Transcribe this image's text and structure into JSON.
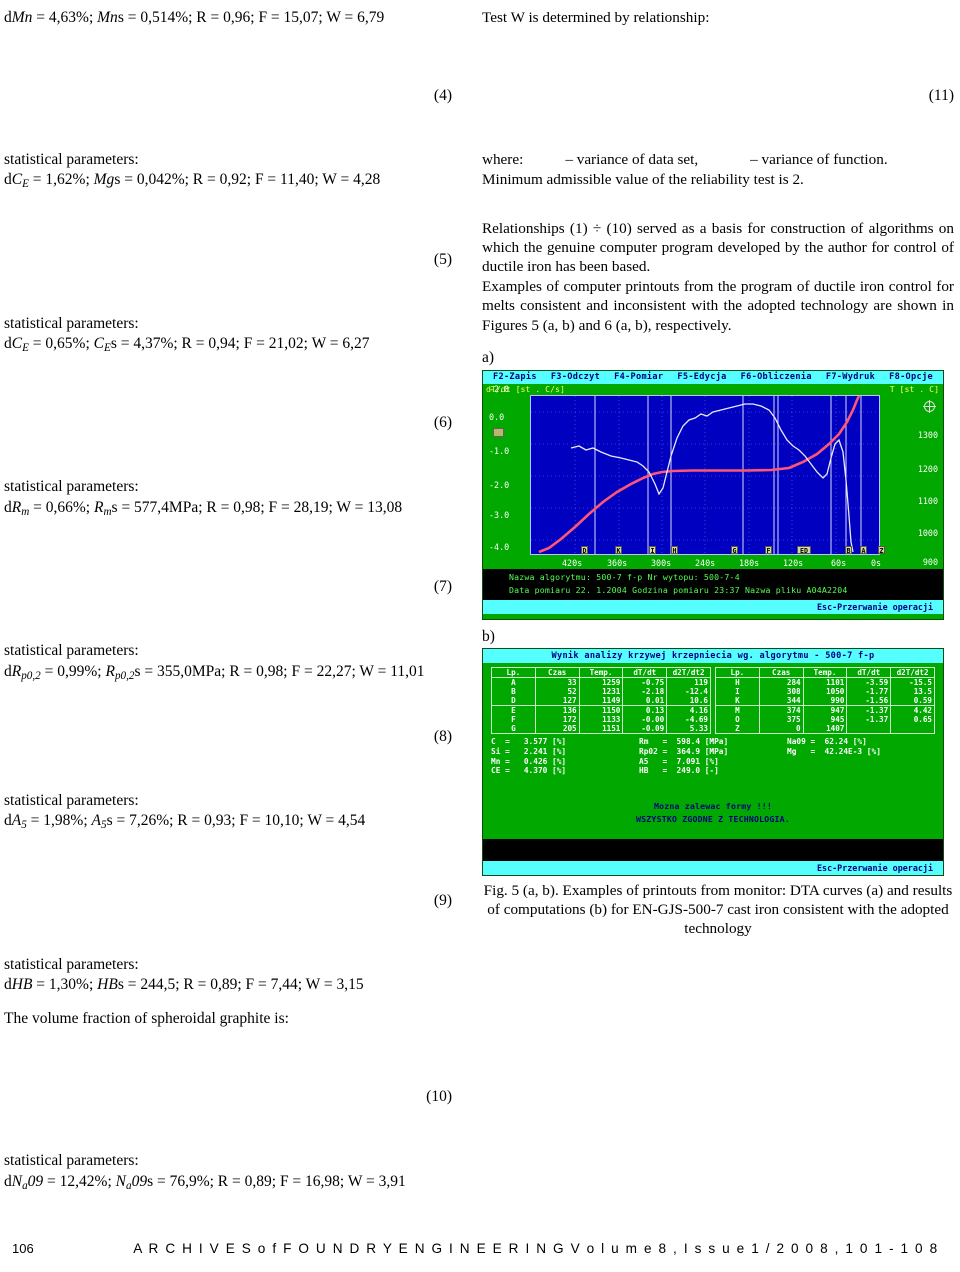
{
  "left_column": {
    "eq4_line": "d<i>Mn</i> = 4,63%; <i>Mn</i>s = 0,514%; R = 0,96; F = 15,07; W = 6,79",
    "eq4_number": "(4)",
    "stat_head": "statistical parameters:",
    "eq5_line": "d<i>C<sub>E</sub></i> = 1,62%; <i>Mg</i>s = 0,042%; R = 0,92; F = 11,40; W = 4,28",
    "eq5_number": "(5)",
    "eq6_line": "d<i>C<sub>E</sub></i> = 0,65%; <i>C<sub>E</sub></i>s = 4,37%; R = 0,94; F = 21,02; W = 6,27",
    "eq6_number": "(6)",
    "eq7_line": "d<i>R<sub>m</sub></i> = 0,66%; <i>R<sub>m</sub></i>s = 577,4MPa; R = 0,98; F = 28,19; W = 13,08",
    "eq7_number": "(7)",
    "eq8_line": "d<i>R<sub>p0,2</sub></i> = 0,99%; <i>R<sub>p0,2</sub></i>s = 355,0MPa; R = 0,98; F = 22,27; W = 11,01",
    "eq8_number": "(8)",
    "eq9_line": "d<i>A<sub>5</sub></i> = 1,98%; <i>A<sub>5</sub></i>s = 7,26%; R = 0,93; F = 10,10; W = 4,54",
    "eq9_number": "(9)",
    "eq10_line": "d<i>HB</i> = 1,30%; <i>HB</i>s = 244,5; R = 0,89; F = 7,44; W = 3,15",
    "volume_fraction_text": "The volume fraction of spheroidal graphite is:",
    "eq10_number": "(10)",
    "eq11_line": "d<i>N<sub>a</sub>09</i> = 12,42%; <i>N<sub>a</sub>09</i>s = 76,9%; R = 0,89; F = 16,98; W = 3,91"
  },
  "right_column": {
    "test_w_text": "Test W is determined by relationship:",
    "eq11_number": "(11)",
    "where_label": "where:",
    "where_a": "– variance of data set,",
    "where_b": "– variance of function.",
    "min_value_text": "Minimum admissible value of the reliability test is 2.",
    "para1": "Relationships (1) ÷ (10) served as a basis for construction of algorithms on which the genuine computer program developed by the author for control of ductile iron has been based.",
    "para2": "Examples of computer printouts from the program of ductile iron control for melts consistent and inconsistent with the adopted technology are shown in Figures 5 (a, b) and 6 (a, b), respectively.",
    "fig_a_label": "a)",
    "fig_b_label": "b)",
    "fig_caption": "Fig. 5 (a, b). Examples of printouts from monitor: DTA curves (a) and  results of computations (b) for EN-GJS-500-7 cast iron consistent with the adopted technology"
  },
  "screenshot_a": {
    "menu_items": [
      "F2-Zapis",
      "F3-Odczyt",
      "F4-Pomiar",
      "F5-Edycja",
      "F6-Obliczenia",
      "F7-Wydruk",
      "F8-Opcje"
    ],
    "axis_title_left": "dT/dt [st . C/s]",
    "axis_title_right": "T [st . C]",
    "y_ticks_left": [
      "0.0",
      "-1.0",
      "-2.0",
      "-3.0",
      "-4.0"
    ],
    "y_ticks_right": [
      "1300",
      "1200",
      "1100",
      "1000",
      "900"
    ],
    "x_ticks": [
      "420s",
      "360s",
      "300s",
      "240s",
      "180s",
      "120s",
      "60s",
      "0s"
    ],
    "markers": [
      "D",
      "K",
      "I",
      "H",
      "G",
      "F",
      "ED",
      "B",
      "A",
      "Z"
    ],
    "status_line1": "Nazwa algorytmu:      500-7     f-p    Nr wytopu: 500-7-4",
    "status_line2": "Data pomiaru 22. 1.2004   Godzina pomiaru 23:37   Nazwa pliku A04A2204",
    "esc_label": "Esc-Przerwanie operacji",
    "colors": {
      "screen_bg": "#00a800",
      "menu_bg": "#55ffff",
      "plot_bg": "#0000c0",
      "status_bg": "#000000",
      "curve_temp": "#ff5577",
      "curve_deriv": "#ffffff"
    }
  },
  "screenshot_b": {
    "title": "Wynik analizy krzywej krzepniecia wg. algorytmu - 500-7      f-p",
    "table_headers": [
      "Lp.",
      "Czas",
      "Temp.",
      "dT/dt",
      "d2T/dt2"
    ],
    "table_left_group1": [
      [
        "A",
        "33",
        "1259",
        "-0.75",
        "119"
      ],
      [
        "B",
        "52",
        "1231",
        "-2.18",
        "-12.4"
      ],
      [
        "D",
        "127",
        "1149",
        "0.01",
        "10.6"
      ]
    ],
    "table_left_group2": [
      [
        "E",
        "136",
        "1150",
        "0.13",
        "4.16"
      ],
      [
        "F",
        "172",
        "1133",
        "-0.00",
        "-4.69"
      ],
      [
        "G",
        "205",
        "1151",
        "-0.09",
        "5.33"
      ]
    ],
    "table_right_group1": [
      [
        "H",
        "284",
        "1101",
        "-3.59",
        "-15.5"
      ],
      [
        "I",
        "308",
        "1050",
        "-1.77",
        "13.5"
      ],
      [
        "K",
        "344",
        "990",
        "-1.56",
        "0.59"
      ]
    ],
    "table_right_group2": [
      [
        "M",
        "374",
        "947",
        "-1.37",
        "4.42"
      ],
      [
        "O",
        "375",
        "945",
        "-1.37",
        "0.65"
      ],
      [
        "Z",
        "0",
        "1407",
        "",
        ""
      ]
    ],
    "summary_col1": [
      "C  =   3.577 [%]",
      "Si =   2.241 [%]",
      "Mn =   0.426 [%]",
      "CE =   4.370 [%]"
    ],
    "summary_col2": [
      "Rm   =  598.4 [MPa]",
      "Rp02 =  364.9 [MPa]",
      "A5   =  7.091 [%]",
      "HB   =  249.0 [-]"
    ],
    "summary_col3": [
      "Na09 =  62.24 [%]",
      "Mg   =  42.24E-3 [%]"
    ],
    "message_line1": "Mozna zalewac formy !!!",
    "message_line2": "WSZYSTKO ZGODNE Z TECHNOLOGIA.",
    "esc_label": "Esc-Przerwanie operacji"
  },
  "footer": {
    "page_number": "106",
    "journal_line": "A R C H I V E S   o f   F O U N D R Y   E N G I N E E R I N G   V o l u m e   8 ,   I s s u e   1 / 2 0 0 8 ,   1 0 1 - 1 0 8"
  }
}
